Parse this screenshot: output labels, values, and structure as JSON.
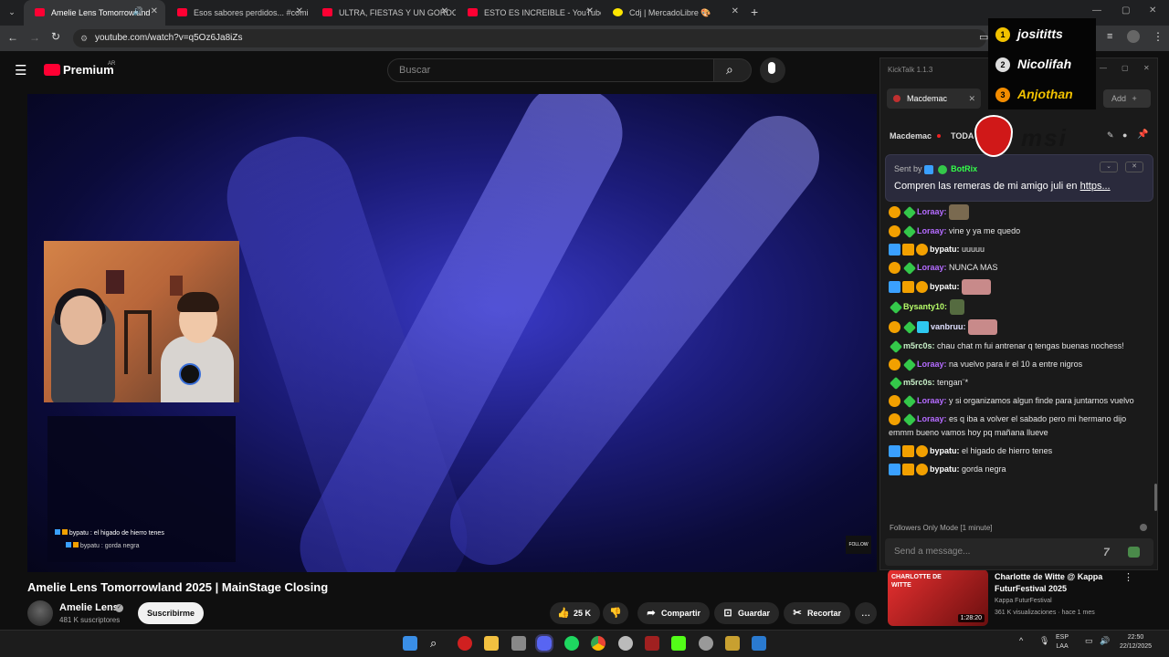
{
  "browser": {
    "tabs": [
      {
        "label": "Amelie Lens Tomorrowland",
        "active": true,
        "type": "youtube"
      },
      {
        "label": "Esos sabores perdidos... #comi",
        "active": false,
        "type": "youtube"
      },
      {
        "label": "ULTRA, FIESTAS Y UN GORDO I",
        "active": false,
        "type": "youtube"
      },
      {
        "label": "ESTO ES INCREIBLE - YouTube",
        "active": false,
        "type": "youtube"
      },
      {
        "label": "Cdj | MercadoLibre 🎨",
        "active": false,
        "type": "mercadolibre"
      }
    ],
    "new_tab": "+",
    "url": "youtube.com/watch?v=q5Oz6Ja8iZs"
  },
  "youtube": {
    "logo": "Premium",
    "region": "AR",
    "search_placeholder": "Buscar",
    "video_title": "Amelie Lens Tomorrowland 2025 | MainStage Closing",
    "channel": {
      "name": "Amelie Lens",
      "subscribers": "481 K suscriptores",
      "subscribe_label": "Suscribirme"
    },
    "actions": {
      "likes": "25 K",
      "share": "Compartir",
      "save": "Guardar",
      "clip": "Recortar",
      "more": "..."
    },
    "overlay_chat": [
      "bypatu : el higado de hierro tenes",
      "bypatu : gorda negra"
    ],
    "overlay_follow": "FOLLOW",
    "recommendation": {
      "title": "Charlotte de Witte @ Kappa FuturFestival 2025",
      "channel": "Kappa FuturFestival",
      "meta": "361 K visualizaciones · hace 1 mes",
      "duration": "1:28:20",
      "thumb_text": "CHARLOTTE DE WITTE"
    }
  },
  "kicktalk": {
    "title": "KickTalk 1.1.3",
    "tab": "Macdemac",
    "add_label": "Add",
    "channel": "Macdemac",
    "mode": "TODA",
    "pinned": {
      "sent_by_label": "Sent by",
      "sender": "BotRix",
      "text": "Compren las remeras de mi amigo juli en ",
      "link": "https..."
    },
    "messages": [
      {
        "user": "Loraay:",
        "text": "",
        "badges": [
          "gold",
          "green"
        ],
        "emote": "pup",
        "color": "lor"
      },
      {
        "user": "Loraay:",
        "text": "vine y ya me quedo",
        "badges": [
          "gold",
          "green"
        ],
        "color": "lor"
      },
      {
        "user": "bypatu:",
        "text": "uuuuu",
        "badges": [
          "blue",
          "crown",
          "gold"
        ],
        "color": "by"
      },
      {
        "user": "Loraay:",
        "text": "NUNCA MAS",
        "badges": [
          "gold",
          "green"
        ],
        "color": "lor"
      },
      {
        "user": "bypatu:",
        "text": "",
        "badges": [
          "blue",
          "crown",
          "gold"
        ],
        "emote": "pink",
        "color": "by"
      },
      {
        "user": "Bysanty10:",
        "text": "",
        "badges": [
          "green"
        ],
        "emote": "small",
        "color": "bys"
      },
      {
        "user": "vanbruu:",
        "text": "",
        "badges": [
          "gold",
          "green",
          "cyan"
        ],
        "emote": "pink",
        "color": "van"
      },
      {
        "user": "m5rc0s:",
        "text": "chau chat m fui antrenar q tengas buenas nochess!",
        "badges": [
          "green"
        ],
        "color": "m5"
      },
      {
        "user": "Loraay:",
        "text": "na vuelvo para ir el 10 a entre nigros",
        "badges": [
          "gold",
          "green"
        ],
        "color": "lor"
      },
      {
        "user": "m5rc0s:",
        "text": "tengan¨*",
        "badges": [
          "green"
        ],
        "color": "m5"
      },
      {
        "user": "Loraay:",
        "text": "y si organizamos algun finde para juntarnos vuelvo",
        "badges": [
          "gold",
          "green"
        ],
        "color": "lor"
      },
      {
        "user": "Loraay:",
        "text": "es q iba a volver el sabado pero mi hermano dijo emmm bueno vamos hoy pq mañana llueve",
        "badges": [
          "gold",
          "green"
        ],
        "color": "lor"
      },
      {
        "user": "bypatu:",
        "text": "el higado de hierro tenes",
        "badges": [
          "blue",
          "crown",
          "gold"
        ],
        "color": "by"
      },
      {
        "user": "bypatu:",
        "text": "gorda negra",
        "badges": [
          "blue",
          "crown",
          "gold"
        ],
        "color": "by"
      }
    ],
    "footer": "Followers Only Mode [1 minute]",
    "send_placeholder": "Send a message..."
  },
  "stream_overlay": {
    "leaderboard": [
      {
        "rank": "1",
        "name": "josititts"
      },
      {
        "rank": "2",
        "name": "Nicolifah"
      },
      {
        "rank": "3",
        "name": "Anjothan"
      }
    ],
    "sponsor": "msi"
  },
  "taskbar": {
    "lang": "ESP",
    "lang2": "LAA",
    "time": "22:50",
    "date": "22/12/2025"
  }
}
